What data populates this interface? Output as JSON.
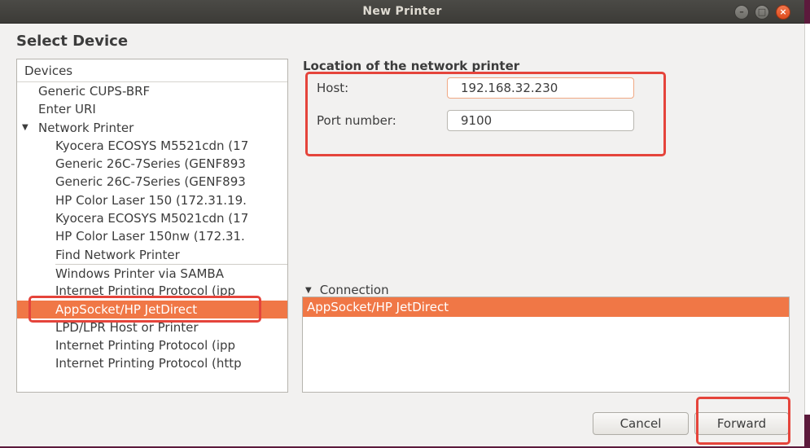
{
  "window": {
    "title": "New Printer"
  },
  "heading": "Select Device",
  "devices": {
    "header": "Devices",
    "items": [
      {
        "label": "Generic CUPS-BRF",
        "level": 0
      },
      {
        "label": "Enter URI",
        "level": 0
      },
      {
        "label": "Network Printer",
        "level": 0,
        "expanded": true
      },
      {
        "label": "Kyocera ECOSYS M5521cdn (17",
        "level": 1
      },
      {
        "label": "Generic 26C-7Series (GENF893",
        "level": 1
      },
      {
        "label": "Generic 26C-7Series (GENF893",
        "level": 1
      },
      {
        "label": "HP Color Laser 150 (172.31.19.",
        "level": 1
      },
      {
        "label": "Kyocera ECOSYS M5021cdn (17",
        "level": 1
      },
      {
        "label": "HP Color Laser 150nw (172.31.",
        "level": 1
      },
      {
        "label": "Find Network Printer",
        "level": 1
      },
      {
        "label": "Windows Printer via SAMBA",
        "level": 1
      },
      {
        "label": "Internet Printing Protocol (ipp",
        "level": 1
      },
      {
        "label": "AppSocket/HP JetDirect",
        "level": 1,
        "selected": true
      },
      {
        "label": "LPD/LPR Host or Printer",
        "level": 1
      },
      {
        "label": "Internet Printing Protocol (ipp",
        "level": 1
      },
      {
        "label": "Internet Printing Protocol (http",
        "level": 1
      }
    ]
  },
  "location": {
    "title": "Location of the network printer",
    "host_label": "Host:",
    "host_value": "192.168.32.230",
    "port_label": "Port number:",
    "port_value": "9100"
  },
  "connection": {
    "label": "Connection",
    "items": [
      "AppSocket/HP JetDirect"
    ]
  },
  "buttons": {
    "cancel": "Cancel",
    "forward": "Forward"
  },
  "colors": {
    "selection": "#f07746",
    "annotation": "#e5443b",
    "titlebar": "#3c3b37"
  }
}
